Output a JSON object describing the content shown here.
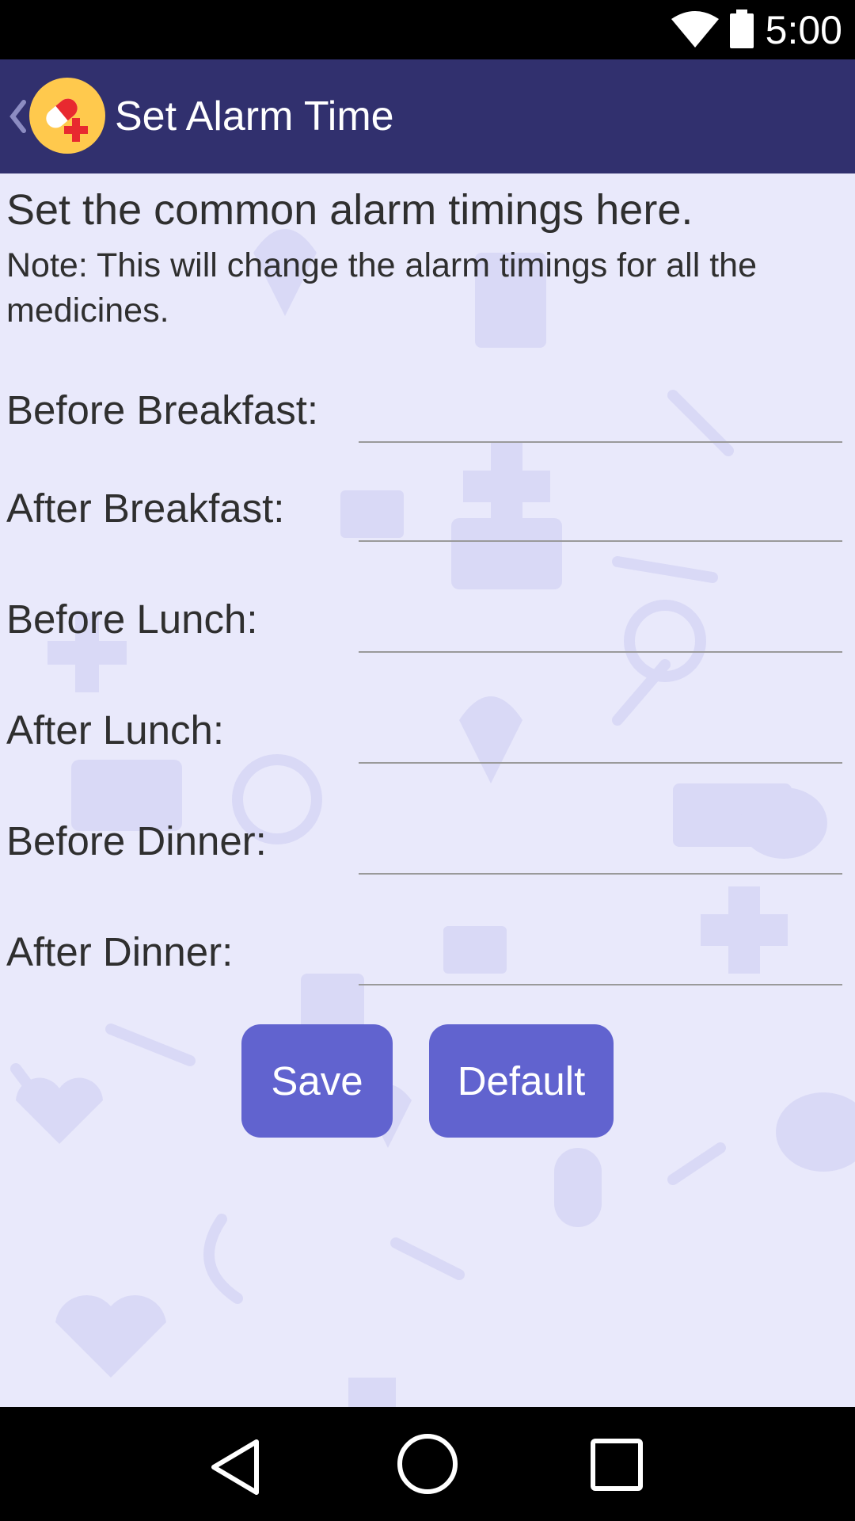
{
  "status_bar": {
    "time": "5:00",
    "icons": [
      "wifi-icon",
      "battery-icon"
    ],
    "background": "#000000"
  },
  "app_bar": {
    "title": "Set Alarm Time",
    "background": "#31306e",
    "back_icon": "chevron-left-icon",
    "logo_icon": "pill-plus-logo-icon",
    "logo_color": "#ffc94d"
  },
  "main": {
    "heading": "Set the common alarm timings here.",
    "note": "Note: This will change the alarm timings for all the medicines.",
    "background": "#e9e9fb",
    "fields": [
      {
        "label": "Before Breakfast:",
        "value": ""
      },
      {
        "label": "After Breakfast:",
        "value": ""
      },
      {
        "label": "Before Lunch:",
        "value": ""
      },
      {
        "label": "After Lunch:",
        "value": ""
      },
      {
        "label": "Before Dinner:",
        "value": ""
      },
      {
        "label": "After Dinner:",
        "value": ""
      }
    ],
    "buttons": {
      "save": "Save",
      "default": "Default",
      "color": "#6163cf"
    }
  },
  "nav_bar": {
    "icons": [
      "nav-back-icon",
      "nav-home-icon",
      "nav-recent-icon"
    ]
  }
}
